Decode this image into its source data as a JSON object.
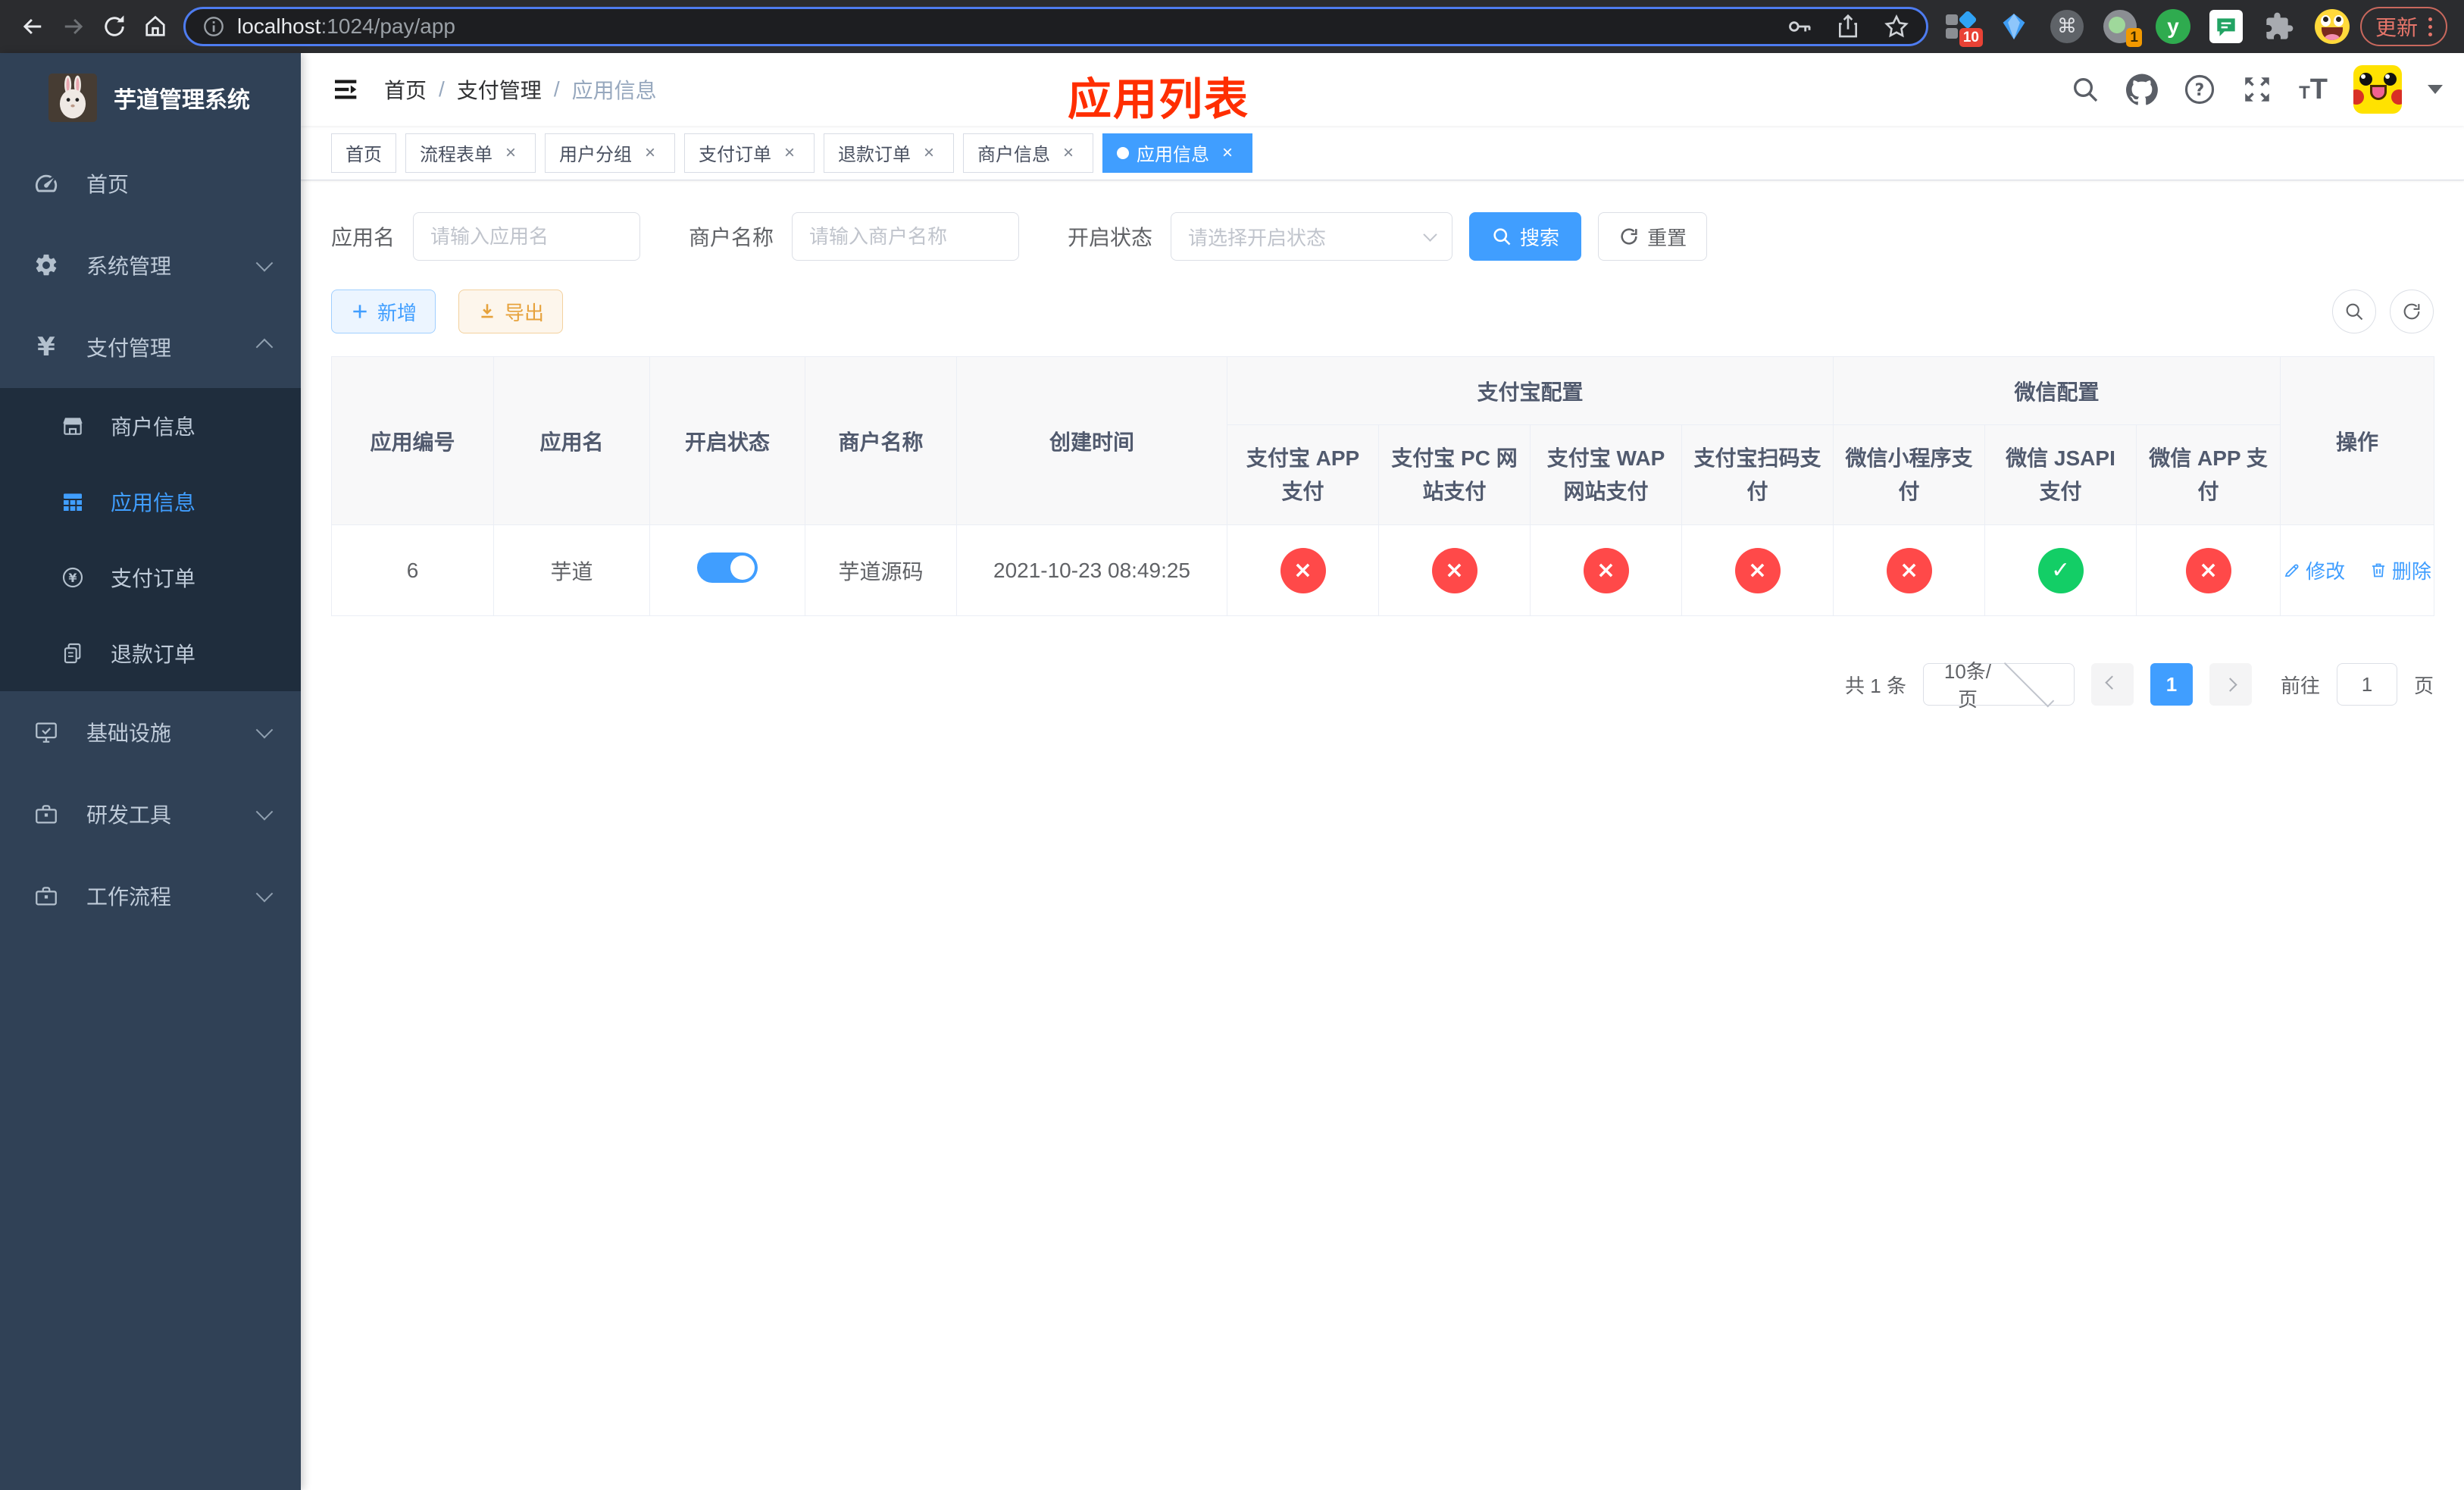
{
  "browser": {
    "url": {
      "host": "localhost",
      "rest": ":1024/pay/app"
    },
    "update_button": "更新",
    "badges": {
      "ext1": "10",
      "ext4": "1"
    },
    "ext_letter": "y"
  },
  "icons": {
    "close": "×",
    "sep": "/",
    "info": "i",
    "question": "?",
    "command": "⌘",
    "yen": "¥",
    "font_large": "T",
    "font_small": "T",
    "status_yes": "✓",
    "status_no": "×"
  },
  "sidebar": {
    "app_title": "芋道管理系统",
    "menu": [
      {
        "label": "首页"
      },
      {
        "label": "系统管理"
      },
      {
        "label": "支付管理"
      },
      {
        "label": "基础设施"
      },
      {
        "label": "研发工具"
      },
      {
        "label": "工作流程"
      }
    ],
    "submenu": [
      {
        "label": "商户信息"
      },
      {
        "label": "应用信息"
      },
      {
        "label": "支付订单"
      },
      {
        "label": "退款订单"
      }
    ]
  },
  "header": {
    "breadcrumb": [
      "首页",
      "支付管理",
      "应用信息"
    ],
    "annotation": "应用列表"
  },
  "tabs": [
    {
      "label": "首页"
    },
    {
      "label": "流程表单"
    },
    {
      "label": "用户分组"
    },
    {
      "label": "支付订单"
    },
    {
      "label": "退款订单"
    },
    {
      "label": "商户信息"
    },
    {
      "label": "应用信息"
    }
  ],
  "filters": {
    "app_name_label": "应用名",
    "app_name_placeholder": "请输入应用名",
    "merchant_label": "商户名称",
    "merchant_placeholder": "请输入商户名称",
    "status_label": "开启状态",
    "status_placeholder": "请选择开启状态",
    "search_button": "搜索",
    "reset_button": "重置"
  },
  "toolbar": {
    "add_button": "新增",
    "export_button": "导出"
  },
  "table": {
    "headers": {
      "app_id": "应用编号",
      "app_name": "应用名",
      "status": "开启状态",
      "merchant": "商户名称",
      "created": "创建时间",
      "alipay_group": "支付宝配置",
      "wechat_group": "微信配置",
      "actions": "操作",
      "alipay_app": "支付宝 APP 支付",
      "alipay_pc": "支付宝 PC 网站支付",
      "alipay_wap": "支付宝 WAP 网站支付",
      "alipay_qr": "支付宝扫码支付",
      "wx_lite": "微信小程序支付",
      "wx_jsapi": "微信 JSAPI 支付",
      "wx_app": "微信 APP 支付"
    },
    "row": {
      "app_id": "6",
      "app_name": "芋道",
      "status_on": true,
      "merchant": "芋道源码",
      "created": "2021-10-23 08:49:25",
      "configs": [
        "no",
        "no",
        "no",
        "no",
        "no",
        "yes",
        "no"
      ],
      "edit": "修改",
      "delete": "删除"
    }
  },
  "pagination": {
    "total": "共 1 条",
    "page_size": "10条/页",
    "current_page": "1",
    "goto_label": "前往",
    "goto_value": "1",
    "page_suffix": "页"
  },
  "colors": {
    "accent": "#409eff",
    "success": "#13ce66",
    "danger": "#ff4949",
    "warning": "#e6a23c",
    "sidebar_bg": "#304156",
    "submenu_bg": "#1f2d3d",
    "annotation": "#ff2e00"
  }
}
